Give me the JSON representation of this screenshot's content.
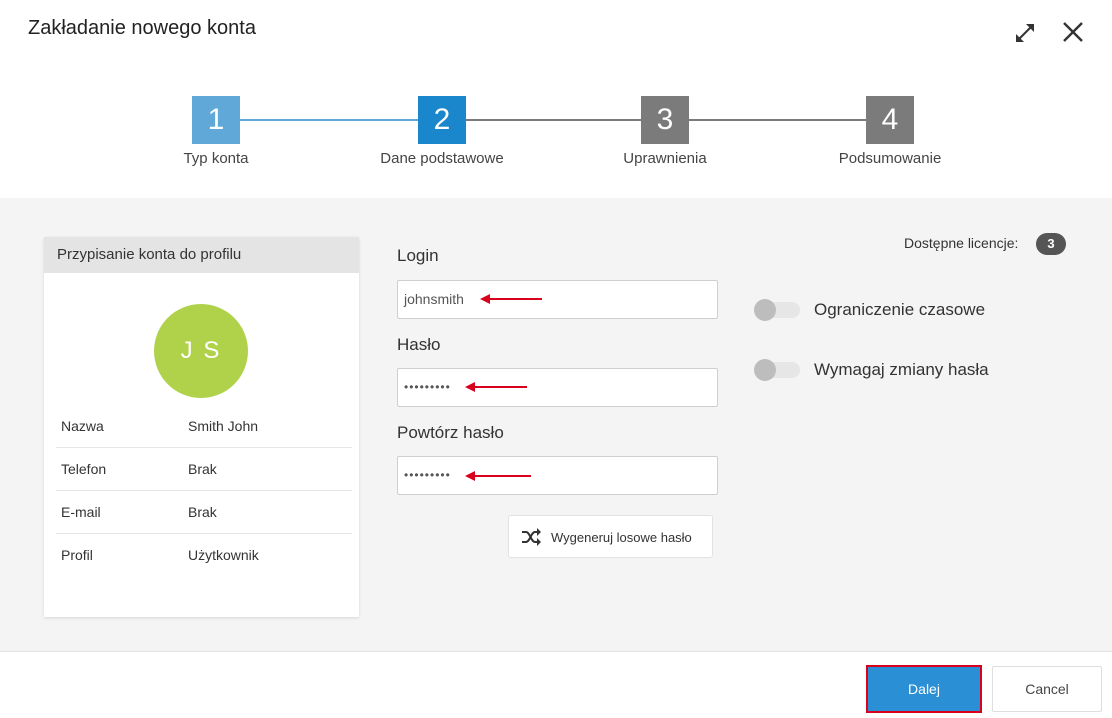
{
  "dialog": {
    "title": "Zakładanie nowego konta",
    "expand_icon": "expand-icon",
    "close_icon": "close-icon"
  },
  "stepper": {
    "steps": [
      {
        "number": "1",
        "label": "Typ konta",
        "state": "completed",
        "color": "#5fa8d8"
      },
      {
        "number": "2",
        "label": "Dane podstawowe",
        "state": "active",
        "color": "#1a86cc"
      },
      {
        "number": "3",
        "label": "Uprawnienia",
        "state": "pending",
        "color": "#7b7b7b"
      },
      {
        "number": "4",
        "label": "Podsumowanie",
        "state": "pending",
        "color": "#7b7b7b"
      }
    ]
  },
  "profile": {
    "header": "Przypisanie konta do profilu",
    "initials": "J S",
    "avatar_color": "#b0d24a",
    "rows": [
      {
        "key": "Nazwa",
        "value": "Smith John"
      },
      {
        "key": "Telefon",
        "value": "Brak"
      },
      {
        "key": "E-mail",
        "value": "Brak"
      },
      {
        "key": "Profil",
        "value": "Użytkownik"
      }
    ]
  },
  "form": {
    "login_label": "Login",
    "login_value": "johnsmith",
    "password_label": "Hasło",
    "password_value": "•••••••••",
    "repeat_label": "Powtórz hasło",
    "repeat_value": "•••••••••",
    "generate_label": "Wygeneruj losowe hasło",
    "generate_icon": "shuffle-icon"
  },
  "options": {
    "licenses_label": "Dostępne licencje:",
    "licenses_count": "3",
    "time_limit_label": "Ograniczenie czasowe",
    "time_limit_on": false,
    "require_change_label": "Wymagaj zmiany hasła",
    "require_change_on": false
  },
  "footer": {
    "next_label": "Dalej",
    "cancel_label": "Cancel"
  },
  "colors": {
    "accent": "#1a86cc",
    "annotation_red": "#d8001c"
  }
}
